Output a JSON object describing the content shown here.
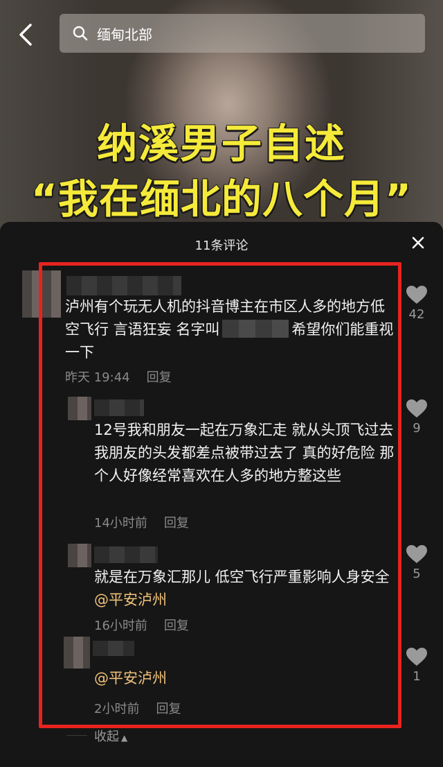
{
  "search": {
    "query": "缅甸北部"
  },
  "video": {
    "headline_line1": "纳溪男子自述",
    "headline_line2": "“我在缅北的八个月”"
  },
  "sheet": {
    "title": "11条评论"
  },
  "comments": [
    {
      "text_before": "泸州有个玩无人机的抖音博主在市区人多的地方低空飞行 言语狂妄 名字叫",
      "text_after": "希望你们能重视一下",
      "time": "昨天 19:44",
      "reply_label": "回复",
      "likes": "42"
    },
    {
      "text": "12号我和朋友一起在万象汇走 就从头顶飞过去 我朋友的头发都差点被带过去了 真的好危险 那个人好像经常喜欢在人多的地方整这些",
      "time": "14小时前",
      "reply_label": "回复",
      "likes": "9"
    },
    {
      "text": "就是在万象汇那儿 低空飞行严重影响人身安全",
      "mention": "@平安泸州",
      "time": "16小时前",
      "reply_label": "回复",
      "likes": "5"
    },
    {
      "mention": "@平安泸州",
      "time": "2小时前",
      "reply_label": "回复",
      "likes": "1"
    }
  ],
  "collapse_label": "收起",
  "colors": {
    "accent_red": "#e8231f",
    "mention": "#f1c37a",
    "headline_yellow": "#f5ea3a"
  },
  "icons": [
    "back-arrow-icon",
    "search-icon",
    "close-icon",
    "heart-icon",
    "caret-up-icon"
  ]
}
